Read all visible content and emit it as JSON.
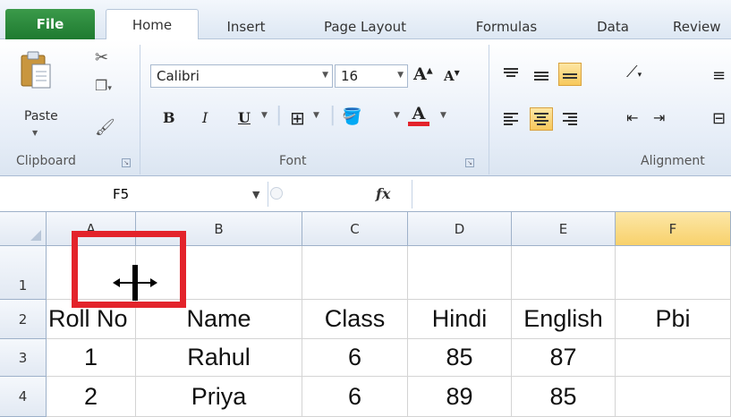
{
  "tabs": [
    {
      "label": "File"
    },
    {
      "label": "Home"
    },
    {
      "label": "Insert"
    },
    {
      "label": "Page Layout"
    },
    {
      "label": "Formulas"
    },
    {
      "label": "Data"
    },
    {
      "label": "Review"
    }
  ],
  "clipboard": {
    "paste_label": "Paste",
    "group_label": "Clipboard",
    "icons": [
      "paste-icon",
      "cut-icon",
      "copy-icon",
      "format-painter-icon"
    ]
  },
  "font": {
    "font_name": "Calibri",
    "font_size": "16",
    "group_label": "Font",
    "bold": "B",
    "italic": "I",
    "underline": "U",
    "font_color_letter": "A"
  },
  "alignment": {
    "group_label": "Alignment"
  },
  "formula_bar": {
    "name_box": "F5",
    "fx": "fx",
    "formula_value": ""
  },
  "columns": [
    "A",
    "B",
    "C",
    "D",
    "E",
    "F"
  ],
  "selected_column": "F",
  "rows": [
    {
      "num": "1",
      "cells": [
        "",
        "",
        "",
        "",
        "",
        ""
      ]
    },
    {
      "num": "2",
      "cells": [
        "Roll No",
        "Name",
        "Class",
        "Hindi",
        "English",
        "Pbi"
      ]
    },
    {
      "num": "3",
      "cells": [
        "1",
        "Rahul",
        "6",
        "85",
        "87",
        ""
      ]
    },
    {
      "num": "4",
      "cells": [
        "2",
        "Priya",
        "6",
        "89",
        "85",
        ""
      ]
    }
  ],
  "colors": {
    "highlight": "#e3232b",
    "selected_header": "#f8d16b",
    "file_tab": "#1e7a30"
  }
}
